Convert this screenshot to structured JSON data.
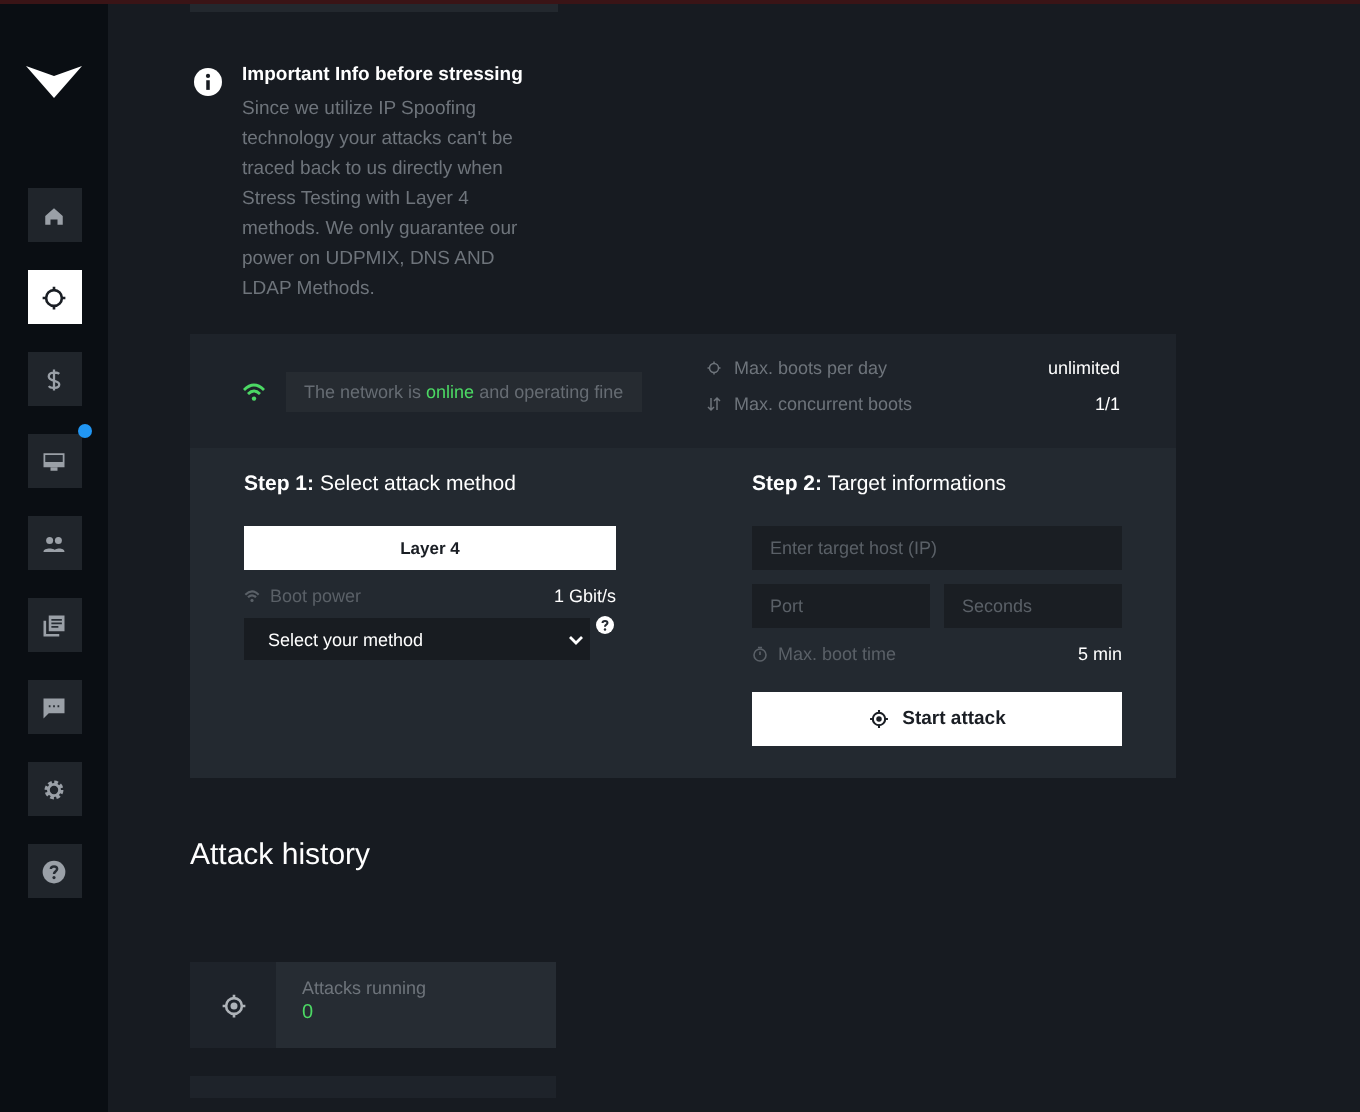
{
  "sidebar": {
    "items": [
      {
        "kind": "home",
        "selected": false,
        "badge": false
      },
      {
        "kind": "target",
        "selected": true,
        "badge": false
      },
      {
        "kind": "dollar",
        "selected": false,
        "badge": false
      },
      {
        "kind": "monitor",
        "selected": false,
        "badge": true
      },
      {
        "kind": "people",
        "selected": false,
        "badge": false
      },
      {
        "kind": "library",
        "selected": false,
        "badge": false
      },
      {
        "kind": "chat",
        "selected": false,
        "badge": false
      },
      {
        "kind": "settings",
        "selected": false,
        "badge": false
      },
      {
        "kind": "help",
        "selected": false,
        "badge": false
      }
    ]
  },
  "info": {
    "title": "Important Info before stressing",
    "text": "Since we utilize IP Spoofing technology your attacks can't be traced back to us directly when Stress Testing with Layer 4 methods. We only guarantee our power on UDPMIX, DNS AND LDAP Methods."
  },
  "status": {
    "before": "The network is",
    "state": "online",
    "after": "and operating fine"
  },
  "limits": [
    {
      "kind": "boots",
      "label": "Max. boots per day",
      "value": "unlimited"
    },
    {
      "kind": "concurrent",
      "label": "Max. concurrent boots",
      "value": "1/1"
    }
  ],
  "step1": {
    "title": "Step 1:",
    "subtitle": "Select attack method",
    "layer": "Layer 4",
    "power_label": "Boot power",
    "power_value": "1 Gbit/s",
    "method_select": "Select your method"
  },
  "step2": {
    "title": "Step 2:",
    "subtitle": "Target informations",
    "host_placeholder": "Enter target host (IP)",
    "port_placeholder": "Port",
    "seconds_placeholder": "Seconds",
    "time_label": "Max. boot time",
    "time_value": "5 min",
    "button": "Start attack"
  },
  "history": {
    "title": "Attack history",
    "cards": [
      {
        "label": "Attacks running",
        "value": "0"
      }
    ]
  }
}
